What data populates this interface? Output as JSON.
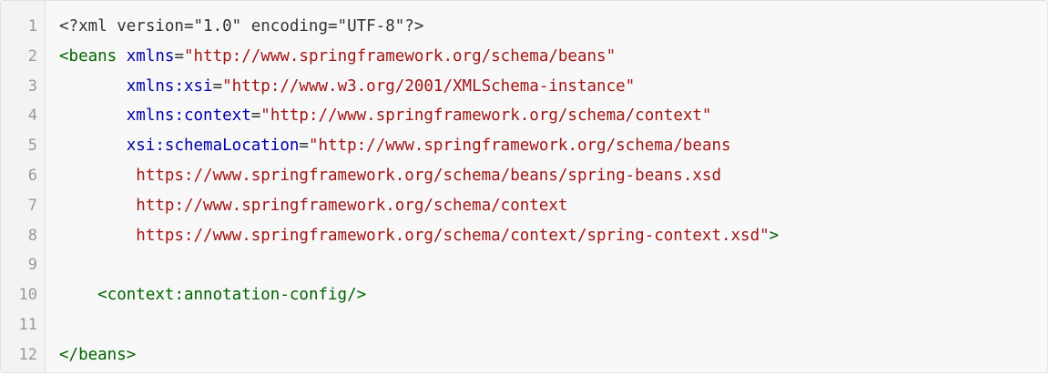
{
  "code": {
    "lines": [
      {
        "num": "1",
        "tokens": [
          {
            "t": "<?xml version=\"1.0\" encoding=\"UTF-8\"?>",
            "c": "plain"
          }
        ]
      },
      {
        "num": "2",
        "tokens": [
          {
            "t": "<beans ",
            "c": "tag"
          },
          {
            "t": "xmlns",
            "c": "attr"
          },
          {
            "t": "=",
            "c": "plain"
          },
          {
            "t": "\"http://www.springframework.org/schema/beans\"",
            "c": "str"
          }
        ]
      },
      {
        "num": "3",
        "tokens": [
          {
            "t": "       ",
            "c": "plain"
          },
          {
            "t": "xmlns:xsi",
            "c": "attr"
          },
          {
            "t": "=",
            "c": "plain"
          },
          {
            "t": "\"http://www.w3.org/2001/XMLSchema-instance\"",
            "c": "str"
          }
        ]
      },
      {
        "num": "4",
        "tokens": [
          {
            "t": "       ",
            "c": "plain"
          },
          {
            "t": "xmlns:context",
            "c": "attr"
          },
          {
            "t": "=",
            "c": "plain"
          },
          {
            "t": "\"http://www.springframework.org/schema/context\"",
            "c": "str"
          }
        ]
      },
      {
        "num": "5",
        "tokens": [
          {
            "t": "       ",
            "c": "plain"
          },
          {
            "t": "xsi:schemaLocation",
            "c": "attr"
          },
          {
            "t": "=",
            "c": "plain"
          },
          {
            "t": "\"http://www.springframework.org/schema/beans",
            "c": "str"
          }
        ]
      },
      {
        "num": "6",
        "tokens": [
          {
            "t": "        ",
            "c": "plain"
          },
          {
            "t": "https://www.springframework.org/schema/beans/spring-beans.xsd",
            "c": "str"
          }
        ]
      },
      {
        "num": "7",
        "tokens": [
          {
            "t": "        ",
            "c": "plain"
          },
          {
            "t": "http://www.springframework.org/schema/context",
            "c": "str"
          }
        ]
      },
      {
        "num": "8",
        "tokens": [
          {
            "t": "        ",
            "c": "plain"
          },
          {
            "t": "https://www.springframework.org/schema/context/spring-context.xsd\"",
            "c": "str"
          },
          {
            "t": ">",
            "c": "tag"
          }
        ]
      },
      {
        "num": "9",
        "tokens": []
      },
      {
        "num": "10",
        "tokens": [
          {
            "t": "    ",
            "c": "plain"
          },
          {
            "t": "<context:annotation-config/>",
            "c": "tag"
          }
        ]
      },
      {
        "num": "11",
        "tokens": []
      },
      {
        "num": "12",
        "tokens": [
          {
            "t": "</beans>",
            "c": "tag"
          }
        ]
      }
    ]
  },
  "colors": {
    "tag": "#006400",
    "attr": "#0000aa",
    "string": "#a31515",
    "plain": "#333333",
    "line_number": "#999999"
  }
}
